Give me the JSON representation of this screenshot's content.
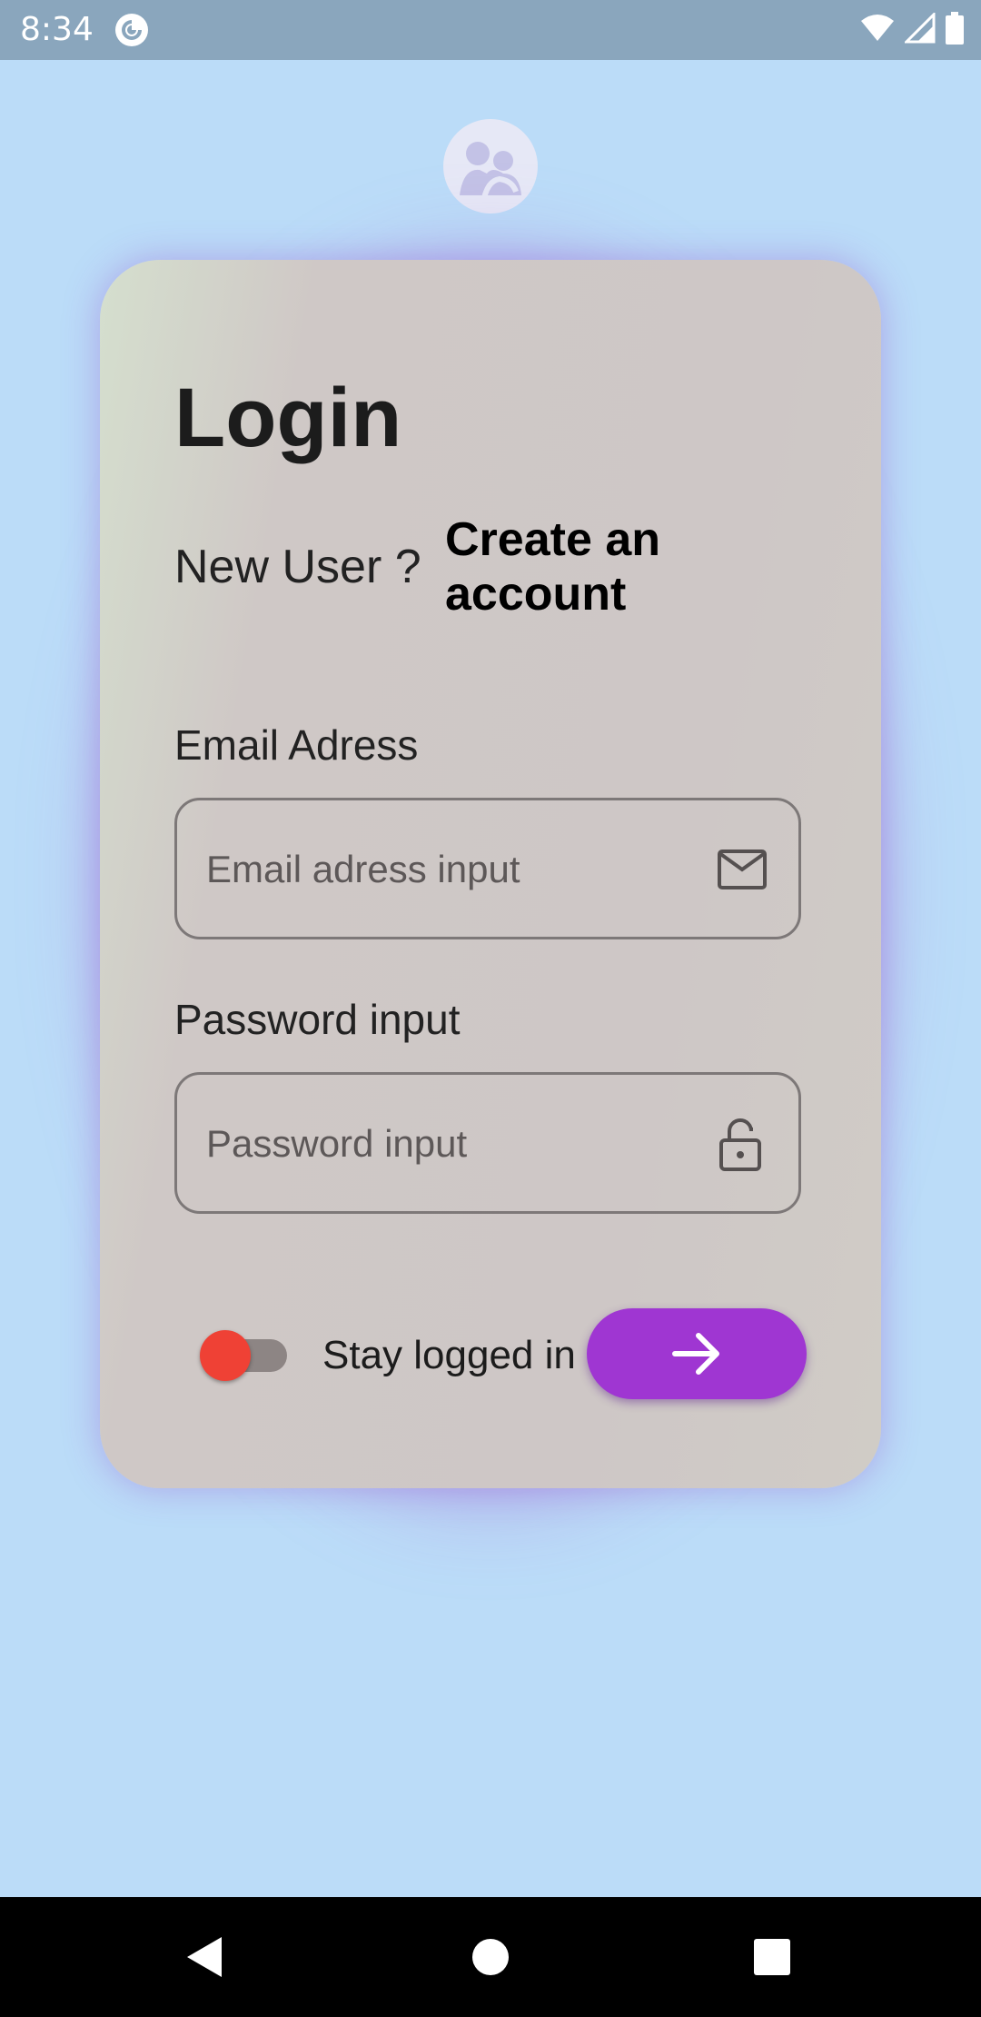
{
  "status_bar": {
    "time": "8:34",
    "app_icon": "pocket-casts-icon",
    "icons": [
      "wifi-icon",
      "signal-icon",
      "battery-icon"
    ]
  },
  "app_logo": "people-logo-icon",
  "login": {
    "title": "Login",
    "new_user_text": "New User ?",
    "create_account_link": "Create an account",
    "email_label": "Email Adress",
    "email_placeholder": "Email adress input",
    "email_value": "",
    "email_icon": "mail-icon",
    "password_label": "Password input",
    "password_placeholder": "Password input",
    "password_value": "",
    "password_icon": "lock-icon",
    "stay_logged_in_label": "Stay logged in",
    "stay_logged_in_on": false,
    "submit_icon": "arrow-right-icon"
  },
  "nav_bar": {
    "buttons": [
      "back-icon",
      "home-icon",
      "recents-icon"
    ]
  },
  "colors": {
    "background": "#bbdcf8",
    "status_bar": "#8aa6bd",
    "accent": "#9f36d2",
    "toggle_thumb": "#ef4135",
    "card": "#cec7c6"
  }
}
